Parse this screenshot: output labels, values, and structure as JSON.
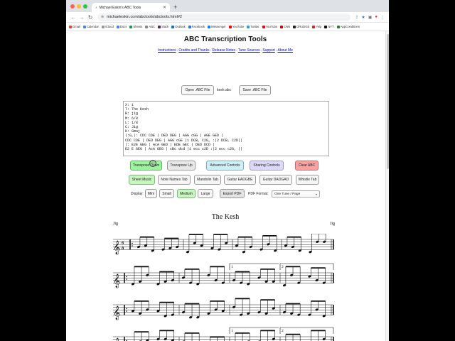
{
  "browser": {
    "tab_title": "Michael Eskin's ABC Tools",
    "url": "michaeleskin.com/abctools/abctools.html#2",
    "bookmarks": [
      "Gmail",
      "Calendar",
      "iCloud",
      "Docs",
      "Sheets",
      "ABC",
      "Slack",
      "Outlook",
      "Facebook",
      "Messenger",
      "YouTube",
      "Twitter",
      "YouTube",
      "CNN",
      "DRUDGE",
      "Yelp",
      "NYT",
      "AppConditions"
    ],
    "bookmark_colors": [
      "#ea4335",
      "#4285f4",
      "#999999",
      "#4285f4",
      "#0f9d58",
      "#888888",
      "#611f69",
      "#0078d4",
      "#1877f2",
      "#0084ff",
      "#ff0000",
      "#1da1f2",
      "#ff0000",
      "#cc0000",
      "#222222",
      "#d32323",
      "#111111",
      "#2e7d32"
    ]
  },
  "page": {
    "title": "ABC Transcription Tools",
    "links": [
      "Instructions",
      "Credits and Thanks",
      "Release Notes",
      "Tune Sources",
      "Support",
      "About Me"
    ],
    "open_button": "Open .ABC File",
    "filename": "kesh.abc",
    "save_button": "Save .ABC File",
    "abc_text": "X: 1\nT: The Kesh\nR: jig\nM: 6/8\nL: 1/8\nC: Jig\nK: Gmaj\n|:G,|: CDC CDE | DED DEG | AGG cGG | AGE GED |\nCDC CDE | DED DEG | AGG cGE |1 DCB, C2G, :|2 DCB, C2D||\n|: E2E GEG | AcA GED | EDE GEC | DED DCD |\nE2 E GEG | AcA GEG | cBc dcd |1 ecc c2D :|2 ecc c2G, ||",
    "row1": [
      "Transpose Down",
      "Transpose Up",
      "Advanced Controls",
      "Sharing Controls",
      "Clear ABC"
    ],
    "row2": [
      "Sheet Music",
      "Note Names Tab",
      "Mandolin Tab",
      "Guitar EADGBE",
      "Guitar DADGAD",
      "Whistle Tab"
    ],
    "display_label": "Display:",
    "display_options": [
      "Mini",
      "Small",
      "Medium",
      "Large"
    ],
    "export_button": "Export PDF",
    "pdf_label": "PDF Format:",
    "pdf_format": "One Tune / Page"
  },
  "sheet": {
    "title": "The Kesh",
    "rhythm": "Jig",
    "composer": "Jig",
    "ending_labels": [
      "1",
      "2",
      "1",
      "2"
    ]
  }
}
